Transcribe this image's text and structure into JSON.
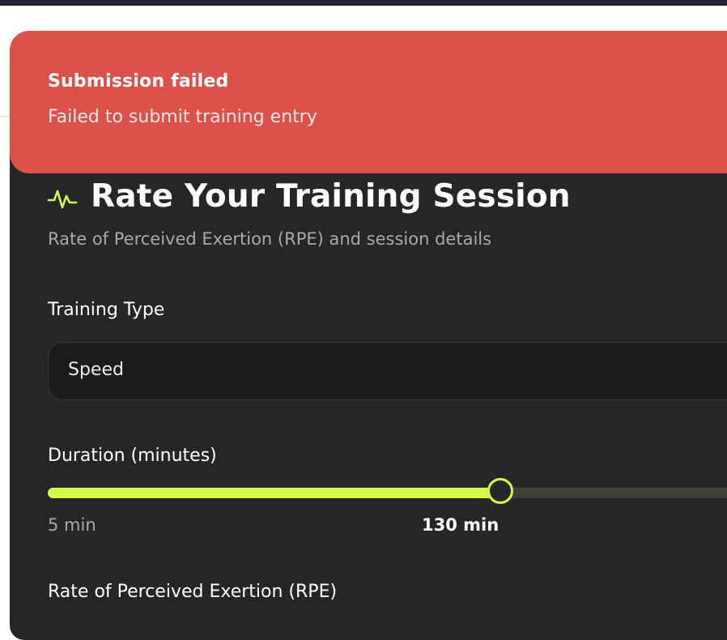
{
  "toast": {
    "title": "Submission failed",
    "description": "Failed to submit training entry"
  },
  "card": {
    "icon": "activity-pulse-icon",
    "title": "Rate Your Training Session",
    "subtitle": "Rate of Perceived Exertion (RPE) and session details"
  },
  "training_type": {
    "label": "Training Type",
    "value": "Speed"
  },
  "duration": {
    "label": "Duration (minutes)",
    "min_label": "5 min",
    "current_label": "130 min",
    "fill_fraction": 0.65
  },
  "rpe": {
    "label": "Rate of Perceived Exertion (RPE)"
  },
  "colors": {
    "accent": "#d4fa4b",
    "toast_error": "#dc524b",
    "card_background": "#262626"
  }
}
